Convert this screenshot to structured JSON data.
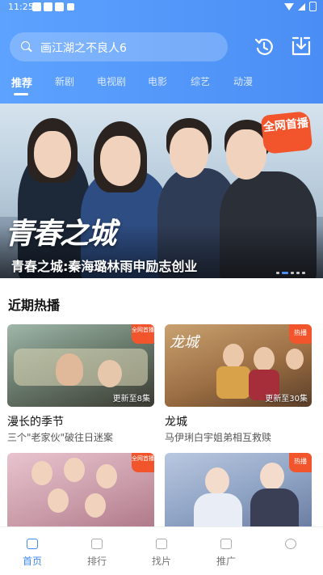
{
  "status_bar": {
    "time": "11:25"
  },
  "search": {
    "placeholder": "画江湖之不良人6"
  },
  "icons": {
    "history": "history-clock-icon",
    "download": "download-icon",
    "search": "search-icon"
  },
  "tabs": [
    {
      "label": "推荐",
      "active": true
    },
    {
      "label": "新剧",
      "active": false
    },
    {
      "label": "电视剧",
      "active": false
    },
    {
      "label": "电影",
      "active": false
    },
    {
      "label": "综艺",
      "active": false
    },
    {
      "label": "动漫",
      "active": false
    }
  ],
  "banner": {
    "logo_text": "青春之城",
    "badge": "全网首播",
    "title": "青春之城:秦海璐林雨申励志创业",
    "page_count": 5,
    "active_page": 1
  },
  "section": {
    "title": "近期热播"
  },
  "cards": [
    {
      "title": "漫长的季节",
      "desc": "三个\"老家伙\"破往日迷案",
      "update": "更新至8集",
      "badge": "全网首播"
    },
    {
      "title": "龙城",
      "desc": "马伊琍白宇姐弟相互救赎",
      "update": "更新至30集",
      "badge": "热播"
    },
    {
      "title": "",
      "desc": "",
      "update": "",
      "badge": "全网首播"
    },
    {
      "title": "",
      "desc": "",
      "update": "",
      "badge": "热播"
    }
  ],
  "nav": [
    {
      "label": "首页",
      "active": true,
      "icon": "home-icon"
    },
    {
      "label": "排行",
      "active": false,
      "icon": "ranking-icon"
    },
    {
      "label": "找片",
      "active": false,
      "icon": "video-search-icon"
    },
    {
      "label": "推广",
      "active": false,
      "icon": "thumbs-up-icon"
    },
    {
      "label": "",
      "active": false,
      "icon": "profile-icon"
    }
  ],
  "colors": {
    "accent": "#3f88f5",
    "header_start": "#5ea2ff",
    "header_end": "#4a8ef5",
    "badge": "#f2552c"
  }
}
